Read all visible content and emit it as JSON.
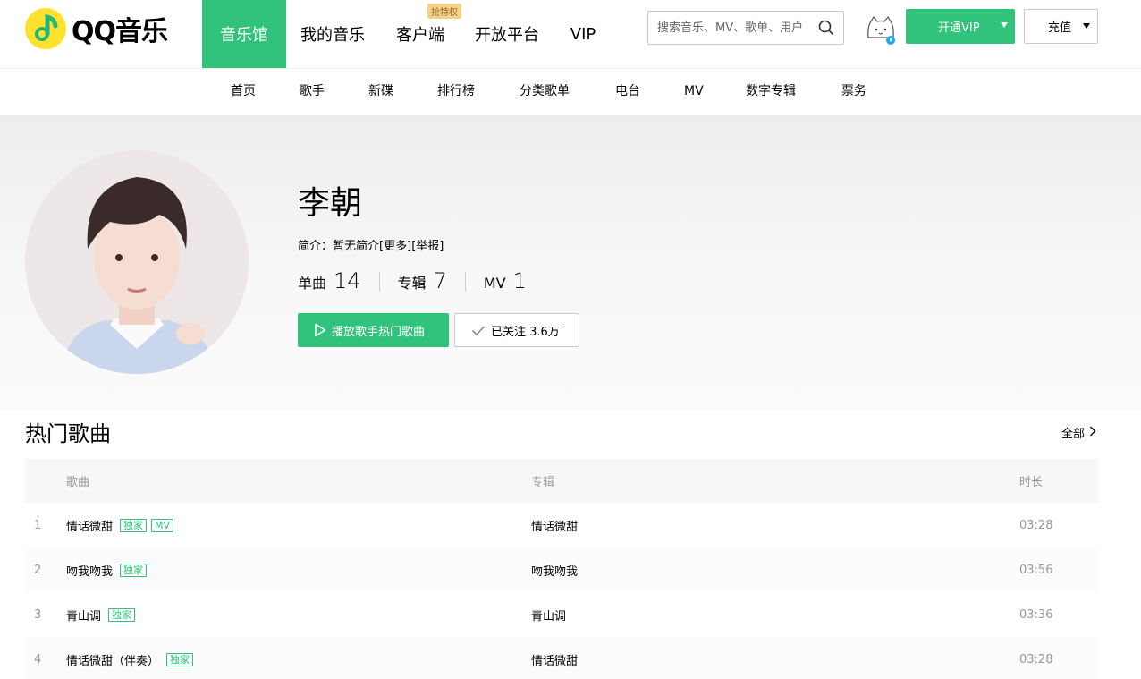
{
  "app": {
    "brand": "QQ音乐",
    "accent": "#31c27c"
  },
  "header": {
    "nav": [
      {
        "label": "音乐馆",
        "active": true
      },
      {
        "label": "我的音乐",
        "active": false
      },
      {
        "label": "客户端",
        "active": false,
        "badge": "抢特权"
      },
      {
        "label": "开放平台",
        "active": false
      },
      {
        "label": "VIP",
        "active": false
      }
    ],
    "search_placeholder": "搜索音乐、MV、歌单、用户",
    "vip_button": "开通VIP",
    "charge_button": "充值"
  },
  "subnav": [
    "首页",
    "歌手",
    "新碟",
    "排行榜",
    "分类歌单",
    "电台",
    "MV",
    "数字专辑",
    "票务"
  ],
  "singer": {
    "name": "李朝",
    "intro_label": "简介：",
    "intro_text": "暂无简介",
    "more_link": "[更多]",
    "report_link": "[举报]",
    "stats": [
      {
        "label": "单曲",
        "value": "14"
      },
      {
        "label": "专辑",
        "value": "7"
      },
      {
        "label": "MV",
        "value": "1"
      }
    ],
    "play_button": "播放歌手热门歌曲",
    "follow_button": "已关注 3.6万"
  },
  "hot_songs": {
    "title": "热门歌曲",
    "all_link": "全部",
    "columns": {
      "song": "歌曲",
      "album": "专辑",
      "duration": "时长"
    },
    "rows": [
      {
        "index": "1",
        "name": "情话微甜",
        "tags": [
          "独家",
          "MV"
        ],
        "album": "情话微甜",
        "duration": "03:28"
      },
      {
        "index": "2",
        "name": "吻我吻我",
        "tags": [
          "独家"
        ],
        "album": "吻我吻我",
        "duration": "03:56"
      },
      {
        "index": "3",
        "name": "青山调",
        "tags": [
          "独家"
        ],
        "album": "青山调",
        "duration": "03:36"
      },
      {
        "index": "4",
        "name": "情话微甜（伴奏）",
        "tags": [
          "独家"
        ],
        "album": "情话微甜",
        "duration": "03:28"
      }
    ]
  }
}
